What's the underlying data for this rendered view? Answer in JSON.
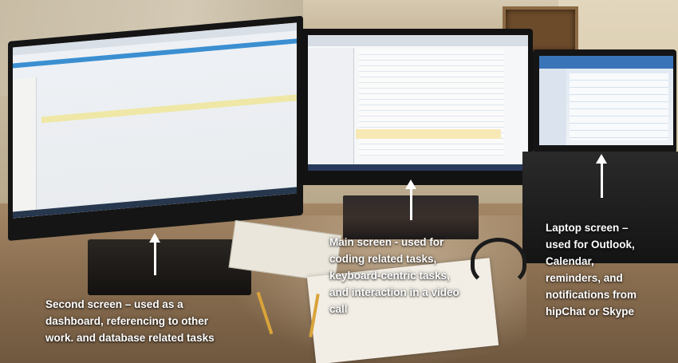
{
  "captions": {
    "second_screen": "Second screen – used as a\ndashboard, referencing to other\nwork. and database related tasks",
    "main_screen": "Main screen - used for\ncoding related tasks,\nkeyboard-centric tasks,\nand interaction in a video\ncall",
    "laptop_screen": "Laptop screen –\nused for Outlook,\nCalendar,\nreminders, and\nnotifications from\nhipChat or Skype"
  },
  "colors": {
    "caption_text": "#ffffff",
    "arrow": "#ffffff"
  },
  "icons": [
    "arrow-up-icon"
  ]
}
